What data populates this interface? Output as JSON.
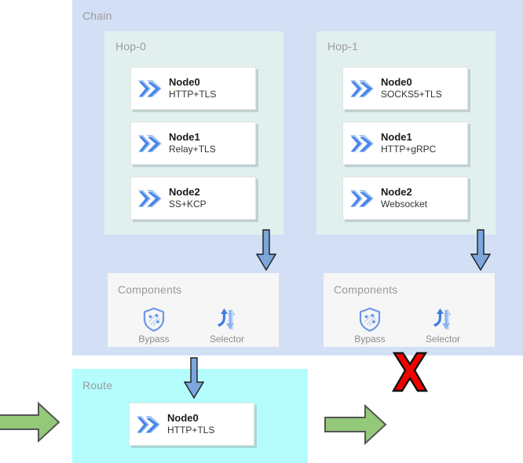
{
  "diagram": {
    "chain": {
      "title": "Chain",
      "hops": [
        {
          "title": "Hop-0",
          "nodes": [
            {
              "name": "Node0",
              "protocol": "HTTP+TLS",
              "icon": "double-chevron-icon"
            },
            {
              "name": "Node1",
              "protocol": "Relay+TLS",
              "icon": "double-chevron-icon"
            },
            {
              "name": "Node2",
              "protocol": "SS+KCP",
              "icon": "double-chevron-icon"
            }
          ],
          "components": {
            "title": "Components",
            "items": [
              {
                "label": "Bypass",
                "icon": "shield-icon"
              },
              {
                "label": "Selector",
                "icon": "selector-arrows-icon"
              }
            ]
          },
          "flow_arrow": "down-arrow-icon",
          "result": "allowed"
        },
        {
          "title": "Hop-1",
          "nodes": [
            {
              "name": "Node0",
              "protocol": "SOCKS5+TLS",
              "icon": "double-chevron-icon"
            },
            {
              "name": "Node1",
              "protocol": "HTTP+gRPC",
              "icon": "double-chevron-icon"
            },
            {
              "name": "Node2",
              "protocol": "Websocket",
              "icon": "double-chevron-icon"
            }
          ],
          "components": {
            "title": "Components",
            "items": [
              {
                "label": "Bypass",
                "icon": "shield-icon"
              },
              {
                "label": "Selector",
                "icon": "selector-arrows-icon"
              }
            ]
          },
          "flow_arrow": "down-arrow-icon",
          "result": "blocked"
        }
      ]
    },
    "route": {
      "title": "Route",
      "node": {
        "name": "Node0",
        "protocol": "HTTP+TLS",
        "icon": "double-chevron-icon"
      }
    },
    "markers": {
      "blocked_icon": "red-x-icon",
      "inbound_arrow": "green-right-arrow-icon",
      "outbound_arrow": "green-right-arrow-icon"
    },
    "colors": {
      "chain_bg": "#d3dff4",
      "hop_bg": "#e1f0ef",
      "components_bg": "#f6f6f6",
      "route_bg": "#b5fdfd",
      "node_card_bg": "#ffffff",
      "blue_arrow": "#7ba7dd",
      "green_arrow": "#94c97a",
      "red_x": "#f50000",
      "title_text": "#9a9a9a",
      "icon_blue_dark": "#3f7fe0",
      "icon_blue_light": "#a8c8f0"
    }
  }
}
